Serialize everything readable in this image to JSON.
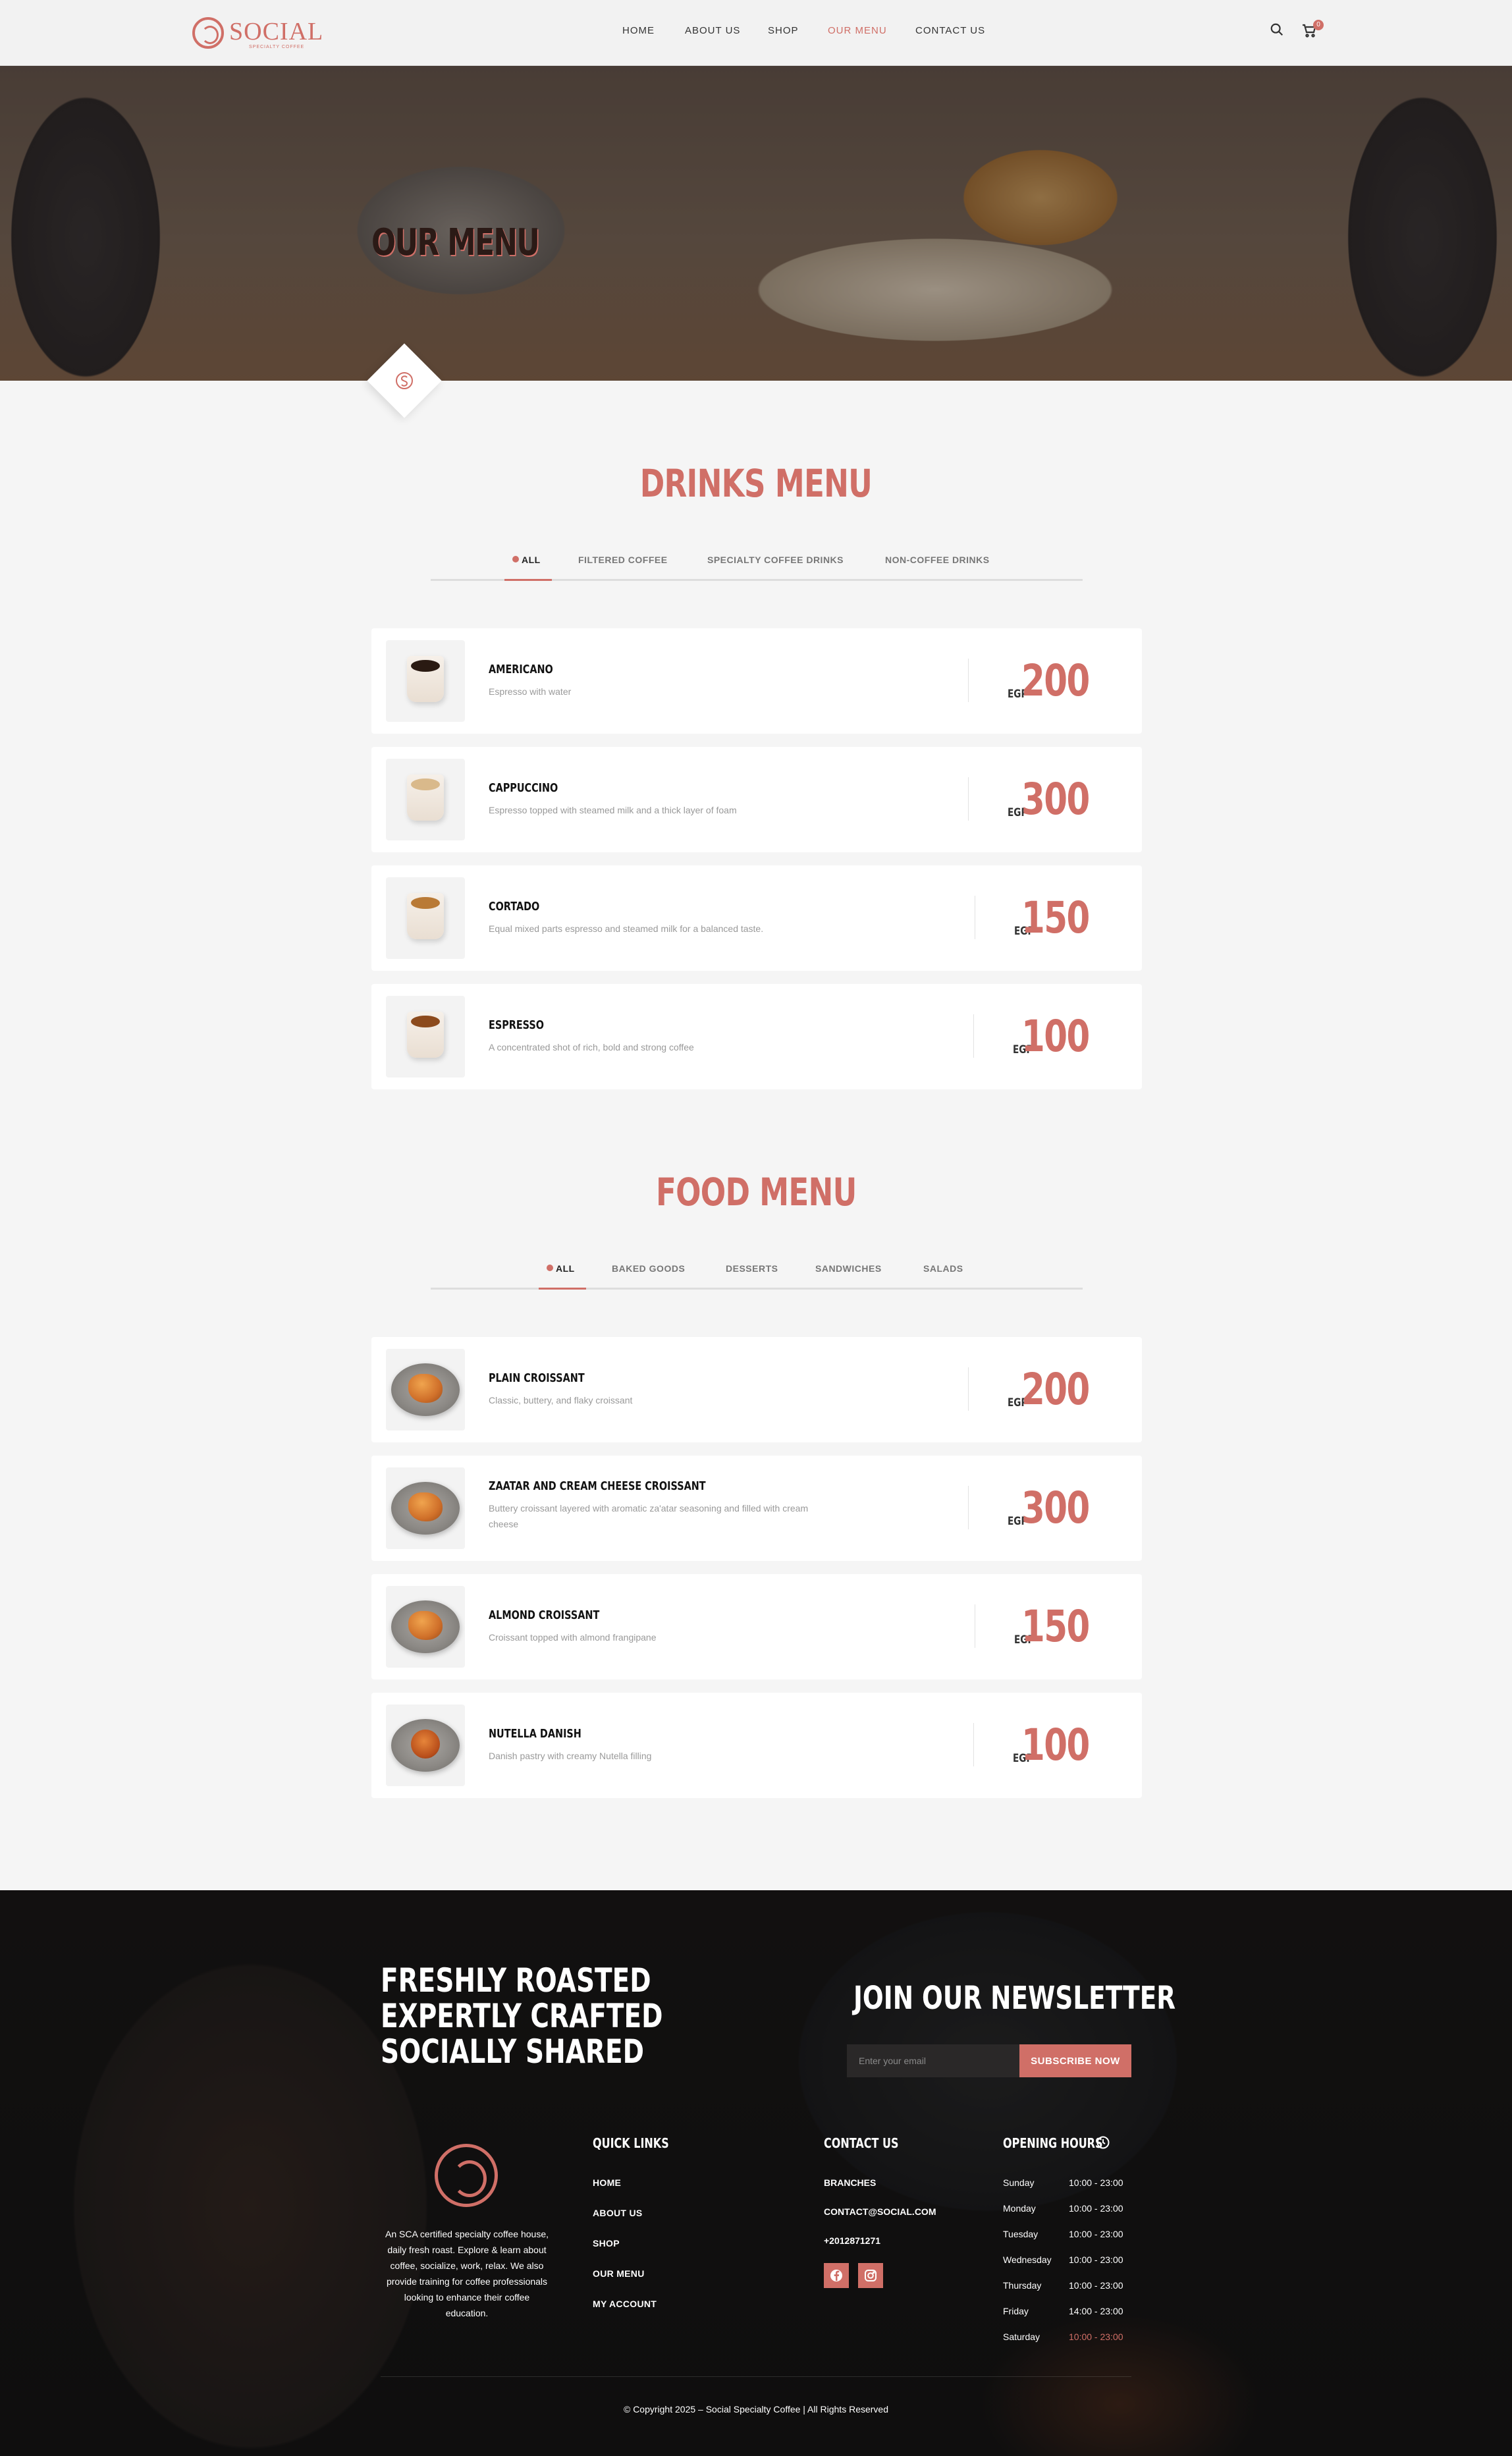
{
  "header": {
    "logo_text": "SOCIAL",
    "logo_sub": "SPECIALTY COFFEE",
    "nav": [
      "HOME",
      "ABOUT US",
      "SHOP",
      "OUR MENU",
      "CONTACT US"
    ],
    "active_nav": "OUR MENU",
    "cart_count": "0"
  },
  "hero": {
    "title": "OUR MENU"
  },
  "drinks": {
    "title": "DRINKS MENU",
    "tabs": [
      "ALL",
      "FILTERED COFFEE",
      "SPECIALTY COFFEE DRINKS",
      "NON-COFFEE DRINKS"
    ],
    "items": [
      {
        "name": "AMERICANO",
        "desc": "Espresso with water",
        "currency": "EGP",
        "price": "200"
      },
      {
        "name": "CAPPUCCINO",
        "desc": "Espresso topped with steamed milk and a thick layer of foam",
        "currency": "EGP",
        "price": "300"
      },
      {
        "name": "CORTADO",
        "desc": "Equal mixed parts espresso and steamed milk for a balanced taste.",
        "currency": "EGP",
        "price": "150"
      },
      {
        "name": "ESPRESSO",
        "desc": "A concentrated shot of rich, bold and strong coffee",
        "currency": "EGP",
        "price": "100"
      }
    ]
  },
  "food": {
    "title": "FOOD MENU",
    "tabs": [
      "ALL",
      "BAKED GOODS",
      "DESSERTS",
      "SANDWICHES",
      "SALADS"
    ],
    "items": [
      {
        "name": "PLAIN CROISSANT",
        "desc": "Classic, buttery, and flaky croissant",
        "currency": "EGP",
        "price": "200"
      },
      {
        "name": "ZAATAR AND CREAM CHEESE CROISSANT",
        "desc": "Buttery croissant layered with aromatic za'atar seasoning and filled with cream cheese",
        "currency": "EGP",
        "price": "300"
      },
      {
        "name": "ALMOND CROISSANT",
        "desc": "Croissant topped with almond frangipane",
        "currency": "EGP",
        "price": "150"
      },
      {
        "name": "NUTELLA DANISH",
        "desc": "Danish pastry with creamy Nutella filling",
        "currency": "EGP",
        "price": "100"
      }
    ]
  },
  "footer": {
    "tagline": [
      "FRESHLY ROASTED",
      "EXPERTLY CRAFTED",
      "SOCIALLY SHARED"
    ],
    "newsletter_title": "JOIN OUR NEWSLETTER",
    "email_placeholder": "Enter your email",
    "subscribe_label": "SUBSCRIBE NOW",
    "about": "An SCA certified specialty coffee house, daily fresh roast. Explore & learn about coffee, socialize, work, relax. We also provide training for coffee professionals looking to enhance their coffee education.",
    "quick_links_title": "QUICK LINKS",
    "quick_links": [
      "HOME",
      "ABOUT US",
      "SHOP",
      "OUR MENU",
      "MY ACCOUNT"
    ],
    "contact_title": "CONTACT US",
    "contact": [
      "BRANCHES",
      "CONTACT@SOCIAL.COM",
      "+2012871271"
    ],
    "social_icons": [
      "facebook-icon",
      "instagram-icon"
    ],
    "hours_title": "OPENING HOURS",
    "hours": [
      {
        "day": "Sunday",
        "time": "10:00 - 23:00"
      },
      {
        "day": "Monday",
        "time": "10:00 - 23:00"
      },
      {
        "day": "Tuesday",
        "time": "10:00 - 23:00"
      },
      {
        "day": "Wednesday",
        "time": "10:00 - 23:00"
      },
      {
        "day": "Thursday",
        "time": "10:00 - 23:00"
      },
      {
        "day": "Friday",
        "time": "14:00 - 23:00"
      },
      {
        "day": "Saturday",
        "time": "10:00 - 23:00"
      }
    ],
    "highlighted_day": "Saturday",
    "copyright": "© Copyright 2025 – Social Specialty Coffee | All Rights Reserved"
  },
  "colors": {
    "accent": "#d06f67",
    "header_bg": "#f2f2f2",
    "page_bg": "#f5f5f5",
    "footer_bg": "#151414"
  }
}
